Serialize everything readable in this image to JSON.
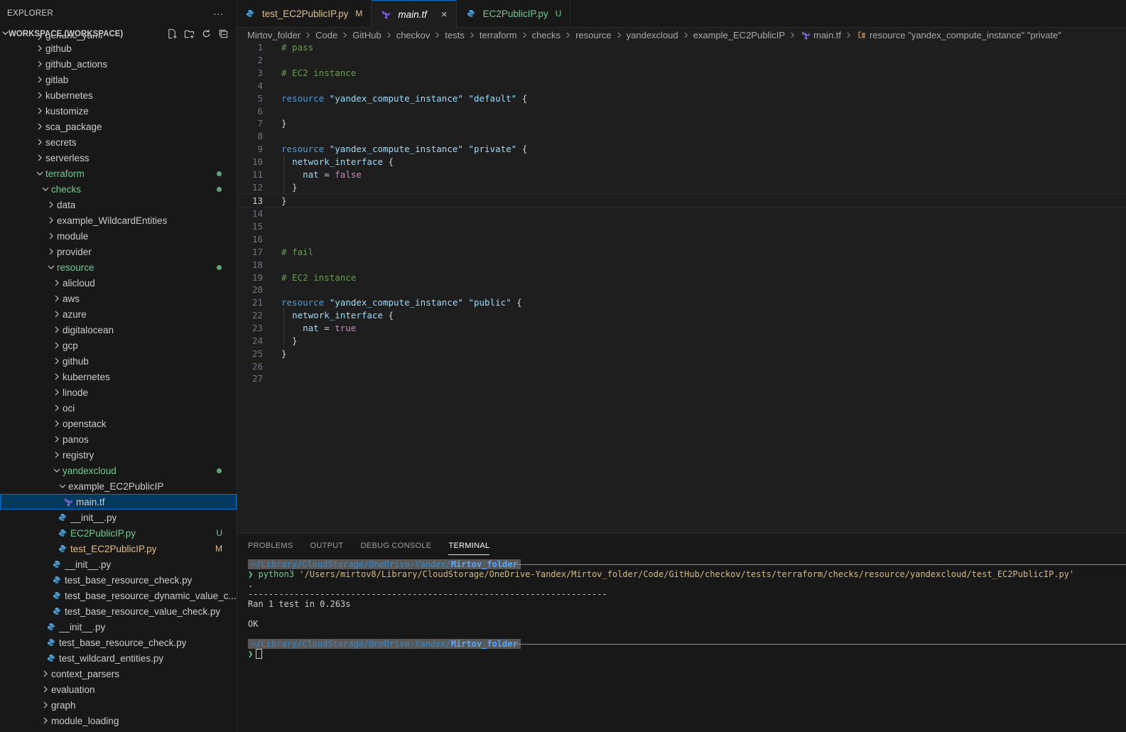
{
  "explorer": {
    "title": "EXPLORER",
    "more": "···",
    "workspace_label": "WORKSPACE (WORKSPACE)"
  },
  "tree": [
    {
      "label": "generic_yaml",
      "indent": 0,
      "type": "folder",
      "open": false,
      "clip": true
    },
    {
      "label": "github",
      "indent": 0,
      "type": "folder",
      "open": false
    },
    {
      "label": "github_actions",
      "indent": 0,
      "type": "folder",
      "open": false
    },
    {
      "label": "gitlab",
      "indent": 0,
      "type": "folder",
      "open": false
    },
    {
      "label": "kubernetes",
      "indent": 0,
      "type": "folder",
      "open": false
    },
    {
      "label": "kustomize",
      "indent": 0,
      "type": "folder",
      "open": false
    },
    {
      "label": "sca_package",
      "indent": 0,
      "type": "folder",
      "open": false
    },
    {
      "label": "secrets",
      "indent": 0,
      "type": "folder",
      "open": false
    },
    {
      "label": "serverless",
      "indent": 0,
      "type": "folder",
      "open": false
    },
    {
      "label": "terraform",
      "indent": 0,
      "type": "folder",
      "open": true,
      "status": "green",
      "dot": true
    },
    {
      "label": "checks",
      "indent": 1,
      "type": "folder",
      "open": true,
      "status": "green",
      "dot": true
    },
    {
      "label": "data",
      "indent": 2,
      "type": "folder",
      "open": false
    },
    {
      "label": "example_WildcardEntities",
      "indent": 2,
      "type": "folder",
      "open": false
    },
    {
      "label": "module",
      "indent": 2,
      "type": "folder",
      "open": false
    },
    {
      "label": "provider",
      "indent": 2,
      "type": "folder",
      "open": false
    },
    {
      "label": "resource",
      "indent": 2,
      "type": "folder",
      "open": true,
      "status": "green",
      "dot": true
    },
    {
      "label": "alicloud",
      "indent": 3,
      "type": "folder",
      "open": false
    },
    {
      "label": "aws",
      "indent": 3,
      "type": "folder",
      "open": false
    },
    {
      "label": "azure",
      "indent": 3,
      "type": "folder",
      "open": false
    },
    {
      "label": "digitalocean",
      "indent": 3,
      "type": "folder",
      "open": false
    },
    {
      "label": "gcp",
      "indent": 3,
      "type": "folder",
      "open": false
    },
    {
      "label": "github",
      "indent": 3,
      "type": "folder",
      "open": false
    },
    {
      "label": "kubernetes",
      "indent": 3,
      "type": "folder",
      "open": false
    },
    {
      "label": "linode",
      "indent": 3,
      "type": "folder",
      "open": false
    },
    {
      "label": "oci",
      "indent": 3,
      "type": "folder",
      "open": false
    },
    {
      "label": "openstack",
      "indent": 3,
      "type": "folder",
      "open": false
    },
    {
      "label": "panos",
      "indent": 3,
      "type": "folder",
      "open": false
    },
    {
      "label": "registry",
      "indent": 3,
      "type": "folder",
      "open": false
    },
    {
      "label": "yandexcloud",
      "indent": 3,
      "type": "folder",
      "open": true,
      "status": "green",
      "dot": true
    },
    {
      "label": "example_EC2PublicIP",
      "indent": 4,
      "type": "folder",
      "open": true
    },
    {
      "label": "main.tf",
      "indent": 5,
      "type": "tf",
      "selected": true
    },
    {
      "label": "__init__.py",
      "indent": 4,
      "type": "py"
    },
    {
      "label": "EC2PublicIP.py",
      "indent": 4,
      "type": "py",
      "status": "green",
      "badge": "U"
    },
    {
      "label": "test_EC2PublicIP.py",
      "indent": 4,
      "type": "py",
      "status": "yellow",
      "badge": "M"
    },
    {
      "label": "__init__.py",
      "indent": 3,
      "type": "py"
    },
    {
      "label": "test_base_resource_check.py",
      "indent": 3,
      "type": "py"
    },
    {
      "label": "test_base_resource_dynamic_value_c...",
      "indent": 3,
      "type": "py"
    },
    {
      "label": "test_base_resource_value_check.py",
      "indent": 3,
      "type": "py"
    },
    {
      "label": "__init__.py",
      "indent": 2,
      "type": "py"
    },
    {
      "label": "test_base_resource_check.py",
      "indent": 2,
      "type": "py"
    },
    {
      "label": "test_wildcard_entities.py",
      "indent": 2,
      "type": "py"
    },
    {
      "label": "context_parsers",
      "indent": 1,
      "type": "folder",
      "open": false
    },
    {
      "label": "evaluation",
      "indent": 1,
      "type": "folder",
      "open": false
    },
    {
      "label": "graph",
      "indent": 1,
      "type": "folder",
      "open": false
    },
    {
      "label": "module_loading",
      "indent": 1,
      "type": "folder",
      "open": false
    }
  ],
  "tabs": [
    {
      "label": "test_EC2PublicIP.py",
      "badge": "M",
      "icon": "python-file-icon",
      "style": "y"
    },
    {
      "label": "main.tf",
      "icon": "terraform-file-icon",
      "active": true,
      "close": "×"
    },
    {
      "label": "EC2PublicIP.py",
      "badge": "U",
      "icon": "python-file-icon",
      "style": "g"
    }
  ],
  "breadcrumbs": [
    "Mirtov_folder",
    "Code",
    "GitHub",
    "checkov",
    "tests",
    "terraform",
    "checks",
    "resource",
    "yandexcloud",
    "example_EC2PublicIP",
    "main.tf",
    "resource \"yandex_compute_instance\" \"private\""
  ],
  "code_lines": [
    {
      "n": "1",
      "t": "# pass"
    },
    {
      "n": "2",
      "t": ""
    },
    {
      "n": "3",
      "t": "# EC2 instance"
    },
    {
      "n": "4",
      "t": ""
    },
    {
      "n": "5",
      "t": "resource \"yandex_compute_instance\" \"default\" {"
    },
    {
      "n": "6",
      "t": ""
    },
    {
      "n": "7",
      "t": "}"
    },
    {
      "n": "8",
      "t": ""
    },
    {
      "n": "9",
      "t": "resource \"yandex_compute_instance\" \"private\" {"
    },
    {
      "n": "10",
      "t": "  network_interface {"
    },
    {
      "n": "11",
      "t": "    nat = false"
    },
    {
      "n": "12",
      "t": "  }"
    },
    {
      "n": "13",
      "t": "}"
    },
    {
      "n": "14",
      "t": ""
    },
    {
      "n": "15",
      "t": ""
    },
    {
      "n": "16",
      "t": ""
    },
    {
      "n": "17",
      "t": "# fail"
    },
    {
      "n": "18",
      "t": ""
    },
    {
      "n": "19",
      "t": "# EC2 instance"
    },
    {
      "n": "20",
      "t": ""
    },
    {
      "n": "21",
      "t": "resource \"yandex_compute_instance\" \"public\" {"
    },
    {
      "n": "22",
      "t": "  network_interface {"
    },
    {
      "n": "23",
      "t": "    nat = true"
    },
    {
      "n": "24",
      "t": "  }"
    },
    {
      "n": "25",
      "t": "}"
    },
    {
      "n": "26",
      "t": ""
    },
    {
      "n": "27",
      "t": ""
    }
  ],
  "current_line": "13",
  "panel": {
    "tabs": [
      "PROBLEMS",
      "OUTPUT",
      "DEBUG CONSOLE",
      "TERMINAL"
    ],
    "active_tab": "TERMINAL"
  },
  "terminal": {
    "prompt_path_dim": "~/Library/CloudStorage/OneDrive-Yandex/",
    "prompt_path_bold": "Mirtov_folder",
    "caret": "❯",
    "cmd_program": "python3",
    "cmd_arg": "'/Users/mirtov8/Library/CloudStorage/OneDrive-Yandex/Mirtov_folder/Code/GitHub/checkov/tests/terraform/checks/resource/yandexcloud/test_EC2PublicIP.py'",
    "dot_line": ".",
    "separator": "----------------------------------------------------------------------",
    "ran": "Ran 1 test in 0.263s",
    "result": "OK"
  },
  "colors": {
    "accent": "#0078d4",
    "git_added": "#73c991",
    "git_modified": "#e2c08d"
  }
}
